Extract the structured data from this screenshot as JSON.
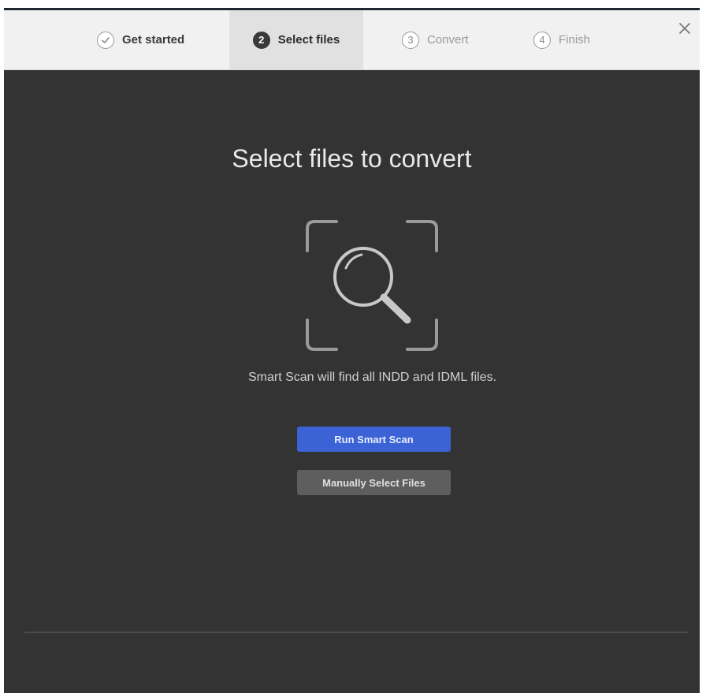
{
  "steps": [
    {
      "number": "",
      "label": "Get started",
      "state": "done",
      "icon": "check-icon"
    },
    {
      "number": "2",
      "label": "Select files",
      "state": "active"
    },
    {
      "number": "3",
      "label": "Convert",
      "state": "pending"
    },
    {
      "number": "4",
      "label": "Finish",
      "state": "pending"
    }
  ],
  "dialog": {
    "close_icon": "close-icon",
    "title": "Select files to convert",
    "scan_icon": "magnifier-scan-icon",
    "description": "Smart Scan will find all INDD and IDML files.",
    "primary_button": "Run Smart Scan",
    "secondary_button": "Manually Select Files"
  },
  "colors": {
    "background": "#333333",
    "stepbar": "#f1f1f1",
    "primary": "#3b63d6",
    "secondary": "#5e5e5e"
  }
}
